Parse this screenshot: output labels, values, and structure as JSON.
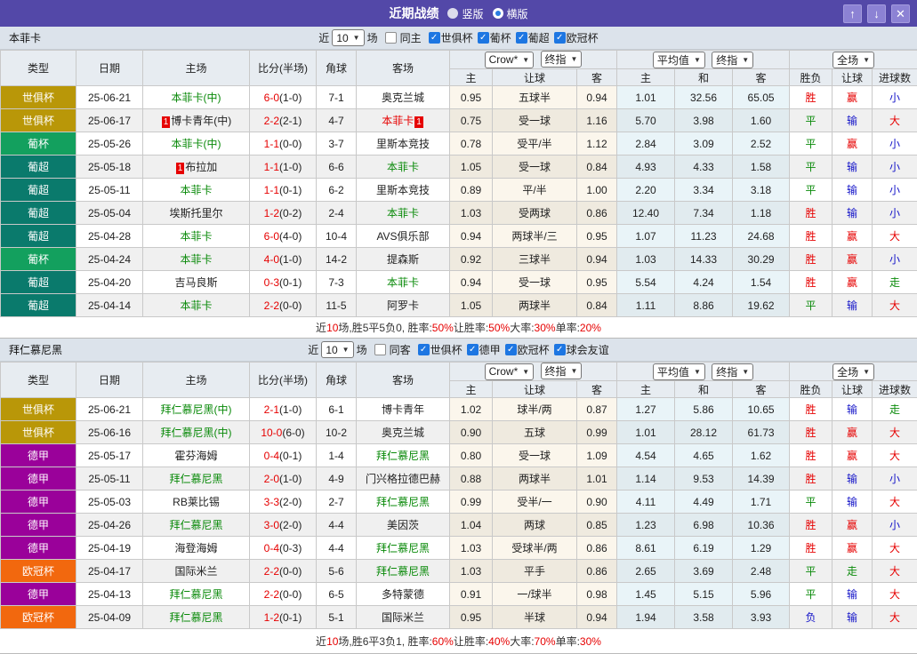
{
  "title_bar": {
    "title": "近期战绩",
    "radio_vertical": "竖版",
    "radio_horizontal": "横版",
    "up_icon": "↑",
    "down_icon": "↓",
    "close_icon": "✕"
  },
  "table_header": {
    "type": "类型",
    "date": "日期",
    "home": "主场",
    "score": "比分(半场)",
    "corner": "角球",
    "away": "客场",
    "odds_source": "Crow*",
    "odds_mode": "终指",
    "avg_source": "平均值",
    "avg_mode": "终指",
    "scope": "全场",
    "sub": {
      "home": "主",
      "handicap": "让球",
      "away": "客",
      "avg_home": "主",
      "avg_draw": "和",
      "avg_away": "客",
      "result": "胜负",
      "cover": "让球",
      "goals": "进球数"
    }
  },
  "league_colors": {
    "世俱杯": "#b99708",
    "葡杯": "#13a05e",
    "葡超": "#0a7a6c",
    "德甲": "#9a019a",
    "欧冠杯": "#f2680e"
  },
  "value_colors": {
    "R": "#e60000",
    "G": "#0a8a0a",
    "B": "#1414c8"
  },
  "sections": [
    {
      "name": "本菲卡",
      "filter": {
        "near": "近",
        "count": "10",
        "unit": "场",
        "same": "同主",
        "leagues": [
          "世俱杯",
          "葡杯",
          "葡超",
          "欧冠杯"
        ]
      },
      "rows": [
        {
          "lg": "世俱杯",
          "date": "25-06-21",
          "home": {
            "t": "本菲卡(中)",
            "s": "focus"
          },
          "sc": "6-0",
          "hf": "(1-0)",
          "cn": "7-1",
          "away": {
            "t": "奥克兰城"
          },
          "h": "0.95",
          "hc": "五球半",
          "a": "0.94",
          "ah": "1.01",
          "ad": "32.56",
          "aa": "65.05",
          "r": [
            "胜",
            "R"
          ],
          "c": [
            "赢",
            "R"
          ],
          "g": [
            "小",
            "B"
          ]
        },
        {
          "lg": "世俱杯",
          "date": "25-06-17",
          "home": {
            "t": "博卡青年(中)",
            "pre": "1"
          },
          "sc": "2-2",
          "hf": "(2-1)",
          "cn": "4-7",
          "away": {
            "t": "本菲卡",
            "s": "red",
            "post": "1"
          },
          "h": "0.75",
          "hc": "受一球",
          "a": "1.16",
          "ah": "5.70",
          "ad": "3.98",
          "aa": "1.60",
          "r": [
            "平",
            "G"
          ],
          "c": [
            "输",
            "B"
          ],
          "g": [
            "大",
            "R"
          ]
        },
        {
          "lg": "葡杯",
          "date": "25-05-26",
          "home": {
            "t": "本菲卡(中)",
            "s": "focus"
          },
          "sc": "1-1",
          "hf": "(0-0)",
          "cn": "3-7",
          "away": {
            "t": "里斯本竞技"
          },
          "h": "0.78",
          "hc": "受平/半",
          "a": "1.12",
          "ah": "2.84",
          "ad": "3.09",
          "aa": "2.52",
          "r": [
            "平",
            "G"
          ],
          "c": [
            "赢",
            "R"
          ],
          "g": [
            "小",
            "B"
          ]
        },
        {
          "lg": "葡超",
          "date": "25-05-18",
          "home": {
            "t": "布拉加",
            "pre": "1"
          },
          "sc": "1-1",
          "hf": "(1-0)",
          "cn": "6-6",
          "away": {
            "t": "本菲卡",
            "s": "focus"
          },
          "h": "1.05",
          "hc": "受一球",
          "a": "0.84",
          "ah": "4.93",
          "ad": "4.33",
          "aa": "1.58",
          "r": [
            "平",
            "G"
          ],
          "c": [
            "输",
            "B"
          ],
          "g": [
            "小",
            "B"
          ]
        },
        {
          "lg": "葡超",
          "date": "25-05-11",
          "home": {
            "t": "本菲卡",
            "s": "focus"
          },
          "sc": "1-1",
          "hf": "(0-1)",
          "cn": "6-2",
          "away": {
            "t": "里斯本竞技"
          },
          "h": "0.89",
          "hc": "平/半",
          "a": "1.00",
          "ah": "2.20",
          "ad": "3.34",
          "aa": "3.18",
          "r": [
            "平",
            "G"
          ],
          "c": [
            "输",
            "B"
          ],
          "g": [
            "小",
            "B"
          ]
        },
        {
          "lg": "葡超",
          "date": "25-05-04",
          "home": {
            "t": "埃斯托里尔"
          },
          "sc": "1-2",
          "hf": "(0-2)",
          "cn": "2-4",
          "away": {
            "t": "本菲卡",
            "s": "focus"
          },
          "h": "1.03",
          "hc": "受两球",
          "a": "0.86",
          "ah": "12.40",
          "ad": "7.34",
          "aa": "1.18",
          "r": [
            "胜",
            "R"
          ],
          "c": [
            "输",
            "B"
          ],
          "g": [
            "小",
            "B"
          ]
        },
        {
          "lg": "葡超",
          "date": "25-04-28",
          "home": {
            "t": "本菲卡",
            "s": "focus"
          },
          "sc": "6-0",
          "hf": "(4-0)",
          "cn": "10-4",
          "away": {
            "t": "AVS俱乐部"
          },
          "h": "0.94",
          "hc": "两球半/三",
          "a": "0.95",
          "ah": "1.07",
          "ad": "11.23",
          "aa": "24.68",
          "r": [
            "胜",
            "R"
          ],
          "c": [
            "赢",
            "R"
          ],
          "g": [
            "大",
            "R"
          ]
        },
        {
          "lg": "葡杯",
          "date": "25-04-24",
          "home": {
            "t": "本菲卡",
            "s": "focus"
          },
          "sc": "4-0",
          "hf": "(1-0)",
          "cn": "14-2",
          "away": {
            "t": "提森斯"
          },
          "h": "0.92",
          "hc": "三球半",
          "a": "0.94",
          "ah": "1.03",
          "ad": "14.33",
          "aa": "30.29",
          "r": [
            "胜",
            "R"
          ],
          "c": [
            "赢",
            "R"
          ],
          "g": [
            "小",
            "B"
          ]
        },
        {
          "lg": "葡超",
          "date": "25-04-20",
          "home": {
            "t": "吉马良斯"
          },
          "sc": "0-3",
          "hf": "(0-1)",
          "cn": "7-3",
          "away": {
            "t": "本菲卡",
            "s": "focus"
          },
          "h": "0.94",
          "hc": "受一球",
          "a": "0.95",
          "ah": "5.54",
          "ad": "4.24",
          "aa": "1.54",
          "r": [
            "胜",
            "R"
          ],
          "c": [
            "赢",
            "R"
          ],
          "g": [
            "走",
            "G"
          ]
        },
        {
          "lg": "葡超",
          "date": "25-04-14",
          "home": {
            "t": "本菲卡",
            "s": "focus"
          },
          "sc": "2-2",
          "hf": "(0-0)",
          "cn": "11-5",
          "away": {
            "t": "阿罗卡"
          },
          "h": "1.05",
          "hc": "两球半",
          "a": "0.84",
          "ah": "1.11",
          "ad": "8.86",
          "aa": "19.62",
          "r": [
            "平",
            "G"
          ],
          "c": [
            "输",
            "B"
          ],
          "g": [
            "大",
            "R"
          ]
        }
      ],
      "summary": [
        [
          "近",
          "k"
        ],
        [
          "10",
          "r"
        ],
        [
          "场,胜5平5负0, 胜率:",
          "k"
        ],
        [
          "50%",
          "r"
        ],
        [
          " 让胜率:",
          "k"
        ],
        [
          "50%",
          "r"
        ],
        [
          " 大率:",
          "k"
        ],
        [
          "30%",
          "r"
        ],
        [
          " 单率:",
          "k"
        ],
        [
          "20%",
          "r"
        ]
      ]
    },
    {
      "name": "拜仁慕尼黑",
      "filter": {
        "near": "近",
        "count": "10",
        "unit": "场",
        "same": "同客",
        "leagues": [
          "世俱杯",
          "德甲",
          "欧冠杯",
          "球会友谊"
        ]
      },
      "rows": [
        {
          "lg": "世俱杯",
          "date": "25-06-21",
          "home": {
            "t": "拜仁慕尼黑(中)",
            "s": "focus"
          },
          "sc": "2-1",
          "hf": "(1-0)",
          "cn": "6-1",
          "away": {
            "t": "博卡青年"
          },
          "h": "1.02",
          "hc": "球半/两",
          "a": "0.87",
          "ah": "1.27",
          "ad": "5.86",
          "aa": "10.65",
          "r": [
            "胜",
            "R"
          ],
          "c": [
            "输",
            "B"
          ],
          "g": [
            "走",
            "G"
          ]
        },
        {
          "lg": "世俱杯",
          "date": "25-06-16",
          "home": {
            "t": "拜仁慕尼黑(中)",
            "s": "focus"
          },
          "sc": "10-0",
          "hf": "(6-0)",
          "cn": "10-2",
          "away": {
            "t": "奥克兰城"
          },
          "h": "0.90",
          "hc": "五球",
          "a": "0.99",
          "ah": "1.01",
          "ad": "28.12",
          "aa": "61.73",
          "r": [
            "胜",
            "R"
          ],
          "c": [
            "赢",
            "R"
          ],
          "g": [
            "大",
            "R"
          ]
        },
        {
          "lg": "德甲",
          "date": "25-05-17",
          "home": {
            "t": "霍芬海姆"
          },
          "sc": "0-4",
          "hf": "(0-1)",
          "cn": "1-4",
          "away": {
            "t": "拜仁慕尼黑",
            "s": "focus"
          },
          "h": "0.80",
          "hc": "受一球",
          "a": "1.09",
          "ah": "4.54",
          "ad": "4.65",
          "aa": "1.62",
          "r": [
            "胜",
            "R"
          ],
          "c": [
            "赢",
            "R"
          ],
          "g": [
            "大",
            "R"
          ]
        },
        {
          "lg": "德甲",
          "date": "25-05-11",
          "home": {
            "t": "拜仁慕尼黑",
            "s": "focus"
          },
          "sc": "2-0",
          "hf": "(1-0)",
          "cn": "4-9",
          "away": {
            "t": "门兴格拉德巴赫"
          },
          "h": "0.88",
          "hc": "两球半",
          "a": "1.01",
          "ah": "1.14",
          "ad": "9.53",
          "aa": "14.39",
          "r": [
            "胜",
            "R"
          ],
          "c": [
            "输",
            "B"
          ],
          "g": [
            "小",
            "B"
          ]
        },
        {
          "lg": "德甲",
          "date": "25-05-03",
          "home": {
            "t": "RB莱比锡"
          },
          "sc": "3-3",
          "hf": "(2-0)",
          "cn": "2-7",
          "away": {
            "t": "拜仁慕尼黑",
            "s": "focus"
          },
          "h": "0.99",
          "hc": "受半/一",
          "a": "0.90",
          "ah": "4.11",
          "ad": "4.49",
          "aa": "1.71",
          "r": [
            "平",
            "G"
          ],
          "c": [
            "输",
            "B"
          ],
          "g": [
            "大",
            "R"
          ]
        },
        {
          "lg": "德甲",
          "date": "25-04-26",
          "home": {
            "t": "拜仁慕尼黑",
            "s": "focus"
          },
          "sc": "3-0",
          "hf": "(2-0)",
          "cn": "4-4",
          "away": {
            "t": "美因茨"
          },
          "h": "1.04",
          "hc": "两球",
          "a": "0.85",
          "ah": "1.23",
          "ad": "6.98",
          "aa": "10.36",
          "r": [
            "胜",
            "R"
          ],
          "c": [
            "赢",
            "R"
          ],
          "g": [
            "小",
            "B"
          ]
        },
        {
          "lg": "德甲",
          "date": "25-04-19",
          "home": {
            "t": "海登海姆"
          },
          "sc": "0-4",
          "hf": "(0-3)",
          "cn": "4-4",
          "away": {
            "t": "拜仁慕尼黑",
            "s": "focus"
          },
          "h": "1.03",
          "hc": "受球半/两",
          "a": "0.86",
          "ah": "8.61",
          "ad": "6.19",
          "aa": "1.29",
          "r": [
            "胜",
            "R"
          ],
          "c": [
            "赢",
            "R"
          ],
          "g": [
            "大",
            "R"
          ]
        },
        {
          "lg": "欧冠杯",
          "date": "25-04-17",
          "home": {
            "t": "国际米兰"
          },
          "sc": "2-2",
          "hf": "(0-0)",
          "cn": "5-6",
          "away": {
            "t": "拜仁慕尼黑",
            "s": "focus"
          },
          "h": "1.03",
          "hc": "平手",
          "a": "0.86",
          "ah": "2.65",
          "ad": "3.69",
          "aa": "2.48",
          "r": [
            "平",
            "G"
          ],
          "c": [
            "走",
            "G"
          ],
          "g": [
            "大",
            "R"
          ]
        },
        {
          "lg": "德甲",
          "date": "25-04-13",
          "home": {
            "t": "拜仁慕尼黑",
            "s": "focus"
          },
          "sc": "2-2",
          "hf": "(0-0)",
          "cn": "6-5",
          "away": {
            "t": "多特蒙德"
          },
          "h": "0.91",
          "hc": "一/球半",
          "a": "0.98",
          "ah": "1.45",
          "ad": "5.15",
          "aa": "5.96",
          "r": [
            "平",
            "G"
          ],
          "c": [
            "输",
            "B"
          ],
          "g": [
            "大",
            "R"
          ]
        },
        {
          "lg": "欧冠杯",
          "date": "25-04-09",
          "home": {
            "t": "拜仁慕尼黑",
            "s": "focus"
          },
          "sc": "1-2",
          "hf": "(0-1)",
          "cn": "5-1",
          "away": {
            "t": "国际米兰"
          },
          "h": "0.95",
          "hc": "半球",
          "a": "0.94",
          "ah": "1.94",
          "ad": "3.58",
          "aa": "3.93",
          "r": [
            "负",
            "B"
          ],
          "c": [
            "输",
            "B"
          ],
          "g": [
            "大",
            "R"
          ]
        }
      ],
      "summary": [
        [
          "近",
          "k"
        ],
        [
          "10",
          "r"
        ],
        [
          "场,胜6平3负1, 胜率:",
          "k"
        ],
        [
          "60%",
          "r"
        ],
        [
          " 让胜率:",
          "k"
        ],
        [
          "40%",
          "r"
        ],
        [
          " 大率:",
          "k"
        ],
        [
          "70%",
          "r"
        ],
        [
          " 单率:",
          "k"
        ],
        [
          "30%",
          "r"
        ]
      ]
    }
  ]
}
